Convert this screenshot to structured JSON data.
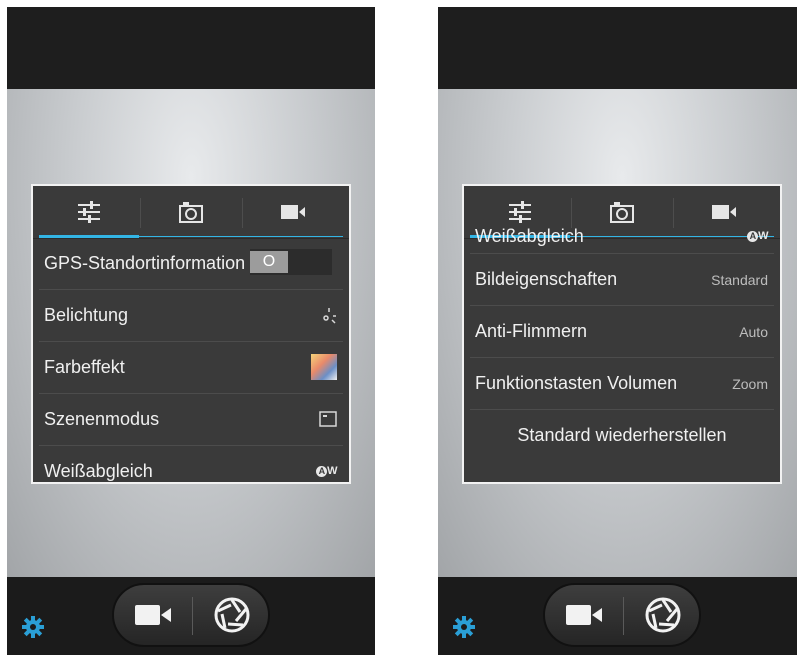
{
  "tabs": [
    {
      "icon": "sliders-icon"
    },
    {
      "icon": "camera-icon"
    },
    {
      "icon": "video-icon"
    }
  ],
  "left_screen": {
    "items": [
      {
        "label": "GPS-Standortinformation",
        "control": "toggle-switch",
        "toggle_text": "O"
      },
      {
        "label": "Belichtung",
        "icon": "exposure-icon"
      },
      {
        "label": "Farbeffekt",
        "icon": "color-effect-icon"
      },
      {
        "label": "Szenenmodus",
        "icon": "scene-mode-icon"
      },
      {
        "label": "Weißabgleich",
        "icon": "white-balance-auto-icon",
        "icon_text": "A",
        "icon_suffix": "W"
      }
    ]
  },
  "right_screen": {
    "items": [
      {
        "label": "Weißabgleich",
        "icon": "white-balance-auto-icon",
        "icon_text": "A",
        "icon_suffix": "W"
      },
      {
        "label": "Bildeigenschaften",
        "value": "Standard"
      },
      {
        "label": "Anti-Flimmern",
        "value": "Auto"
      },
      {
        "label": "Funktionstasten Volumen",
        "value": "Zoom"
      }
    ],
    "reset_label": "Standard wiederherstellen"
  },
  "bottom_bar": {
    "settings_icon": "gear-icon",
    "video_icon": "video-camera-icon",
    "shutter_icon": "shutter-icon"
  },
  "colors": {
    "accent": "#33b5e5",
    "panel_bg": "#3a3a3a",
    "bar_bg": "#1b1b1b",
    "settings_icon": "#2a9fd6"
  }
}
